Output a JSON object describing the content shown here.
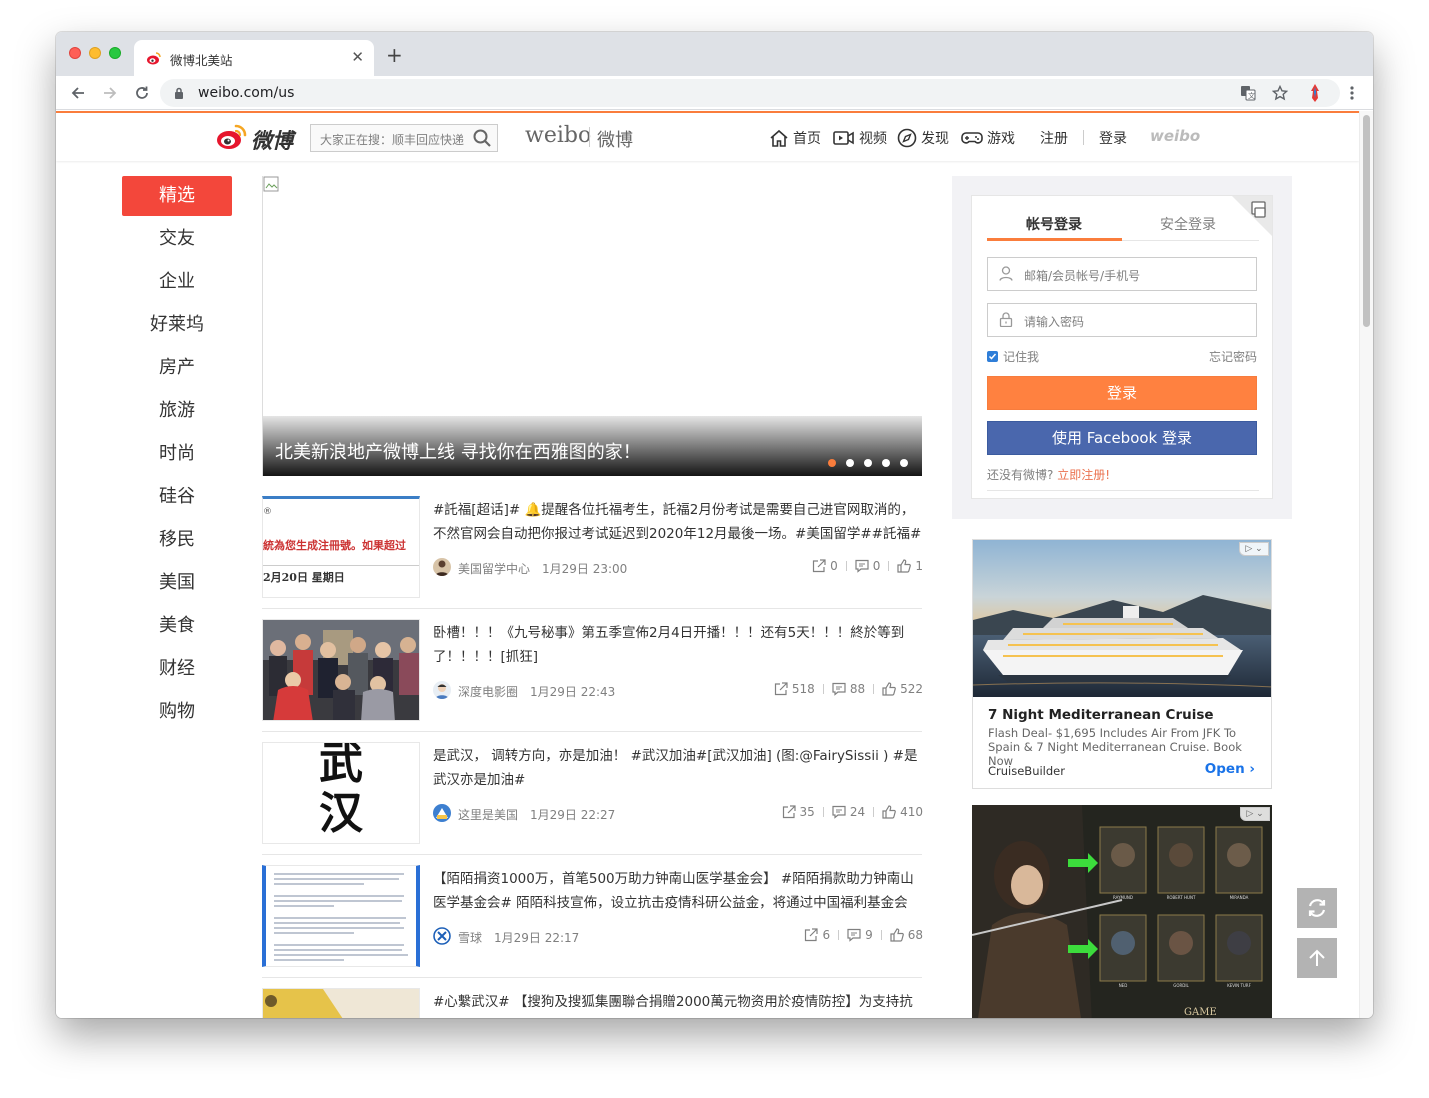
{
  "browser": {
    "tab_title": "微博北美站",
    "url": "weibo.com/us",
    "new_tab_label": "+",
    "close_tab_label": "✕"
  },
  "header": {
    "logo_text": "微博",
    "search_placeholder": "大家正在搜：顺丰回应快递",
    "brand_en": "weibo",
    "brand_cn": "微博",
    "nav": {
      "home": "首页",
      "video": "视频",
      "discover": "发现",
      "games": "游戏",
      "register": "注册",
      "login": "登录"
    },
    "weibo_mark": "weibo"
  },
  "categories": [
    "精选",
    "交友",
    "企业",
    "好莱坞",
    "房产",
    "旅游",
    "时尚",
    "硅谷",
    "移民",
    "美国",
    "美食",
    "财经",
    "购物"
  ],
  "carousel": {
    "caption": "北美新浪地产微博上线 寻找你在西雅图的家！",
    "slide_count": 5,
    "active_slide": 1
  },
  "feed": [
    {
      "text": "#託福[超话]# 🔔提醒各位托福考生，託福2月份考试是需要自己进官网取消的，不然官网会自动把你报过考试延迟到2020年12月最後一场。#美国留学##託福#",
      "author": "美国留学中心",
      "time": "1月29日 23:00",
      "reposts": "0",
      "comments": "0",
      "likes": "1",
      "thumb_line1": "®",
      "thumb_line2": "統為您生成注冊號。如果超过",
      "thumb_line3": "2月20日 星期日"
    },
    {
      "text": "卧槽！！！《九号秘事》第五季宣佈2月4日开播！！！还有5天！！！終於等到了！！！！[抓狂]",
      "author": "深度电影圈",
      "time": "1月29日 22:43",
      "reposts": "518",
      "comments": "88",
      "likes": "522"
    },
    {
      "text": "是武汉， 调转方向，亦是加油！ #武汉加油#[武汉加油] (图:@FairySissii ) #是武汉亦是加油#",
      "author": "这里是美国",
      "time": "1月29日 22:27",
      "reposts": "35",
      "comments": "24",
      "likes": "410",
      "thumb_calligraphy": "武汉"
    },
    {
      "text": "【陌陌捐资1000万，首笔500万助力钟南山医学基金会】 #陌陌捐款助力钟南山医学基金会# 陌陌科技宣佈，设立抗击疫情科研公益金，将通过中国福利基金会",
      "author": "雪球",
      "time": "1月29日 22:17",
      "reposts": "6",
      "comments": "9",
      "likes": "68"
    },
    {
      "text": "#心繫武汉# 【搜狗及搜狐集團聯合捐贈2000萬元物资用於疫情防控】为支持抗",
      "author": "",
      "time": "",
      "reposts": "",
      "comments": "",
      "likes": ""
    }
  ],
  "login": {
    "tab_account": "帐号登录",
    "tab_secure": "安全登录",
    "username_placeholder": "邮箱/会员帐号/手机号",
    "password_placeholder": "请输入密码",
    "remember": "记住我",
    "forgot": "忘记密码",
    "login_button": "登录",
    "facebook_button": "使用 Facebook 登录",
    "no_account": "还没有微博?",
    "register_link": "立即注册!"
  },
  "ads": [
    {
      "title": "7 Night Mediterranean Cruise",
      "description": "Flash Deal- $1,695 Includes Air From JFK To Spain & 7 Night Mediterranean Cruise. Book Now",
      "source": "CruiseBuilder",
      "cta": "Open"
    },
    {
      "card_names": [
        "RAYMUND",
        "ROBERT HUNT",
        "MIRANDA",
        "NED",
        "GORDIL",
        "KEVIN TURF"
      ],
      "logo_text": "GAME"
    }
  ],
  "colors": {
    "accent_orange": "#fa7d3c",
    "active_red": "#f3473b",
    "facebook_blue": "#4a67ad",
    "login_orange": "#ff8140"
  },
  "icons": [
    "back-icon",
    "forward-icon",
    "reload-icon",
    "lock-icon",
    "translate-icon",
    "star-icon",
    "extension-icon",
    "menu-icon",
    "search-icon",
    "home-icon",
    "video-icon",
    "discover-icon",
    "game-icon",
    "refresh-icon",
    "back-to-top-icon"
  ]
}
